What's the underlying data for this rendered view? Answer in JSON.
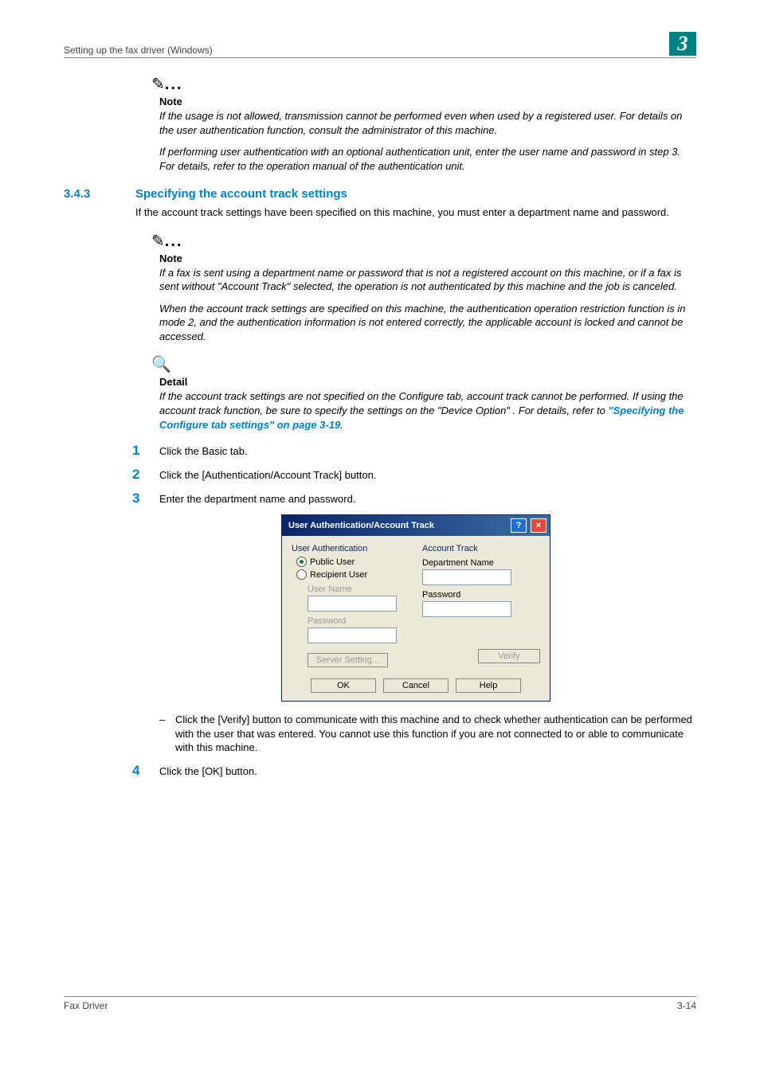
{
  "header": {
    "left": "Setting up the fax driver (Windows)",
    "badge": "3"
  },
  "note1": {
    "label": "Note",
    "p1": "If the usage is not allowed, transmission cannot be performed even when used by a registered user. For details on the user authentication function, consult the administrator of this machine.",
    "p2": "If performing user authentication with an optional authentication unit, enter the user name and password in step 3. For details, refer to the operation manual of the authentication unit."
  },
  "section": {
    "num": "3.4.3",
    "title": "Specifying the account track settings",
    "intro": "If the account track settings have been specified on this machine, you must enter a department name and password."
  },
  "note2": {
    "label": "Note",
    "p1": "If a fax is sent using a department name or password that is not a registered account on this machine, or if a fax is sent without \"Account Track\" selected, the operation is not authenticated by this machine and the job is canceled.",
    "p2": "When the account track settings are specified on this machine, the authentication operation restriction function is in mode 2, and the authentication information is not entered correctly, the applicable account is locked and cannot be accessed."
  },
  "detail": {
    "label": "Detail",
    "p_a": "If the account track settings are not specified on the Configure tab, account track cannot be performed. If using the account track function, be sure to specify the settings on the \"Device Option\" . For details, refer to ",
    "link": "\"Specifying the Configure tab settings\" on page 3-19",
    "p_b": "."
  },
  "steps": {
    "s1": "Click the Basic tab.",
    "s2": "Click the [Authentication/Account Track] button.",
    "s3": "Enter the department name and password.",
    "s4": "Click the [OK] button.",
    "sub3": "Click the [Verify] button to communicate with this machine and to check whether authentication can be performed with the user that was entered. You cannot use this function if you are not connected to or able to communicate with this machine."
  },
  "dialog": {
    "title": "User Authentication/Account Track",
    "left": {
      "heading": "User Authentication",
      "public": "Public User",
      "recipient": "Recipient User",
      "username": "User Name",
      "password": "Password",
      "server": "Server Setting..."
    },
    "right": {
      "heading": "Account Track",
      "dept": "Department Name",
      "password": "Password",
      "verify": "Verify"
    },
    "footer": {
      "ok": "OK",
      "cancel": "Cancel",
      "help": "Help"
    }
  },
  "footer": {
    "left": "Fax Driver",
    "right": "3-14"
  }
}
